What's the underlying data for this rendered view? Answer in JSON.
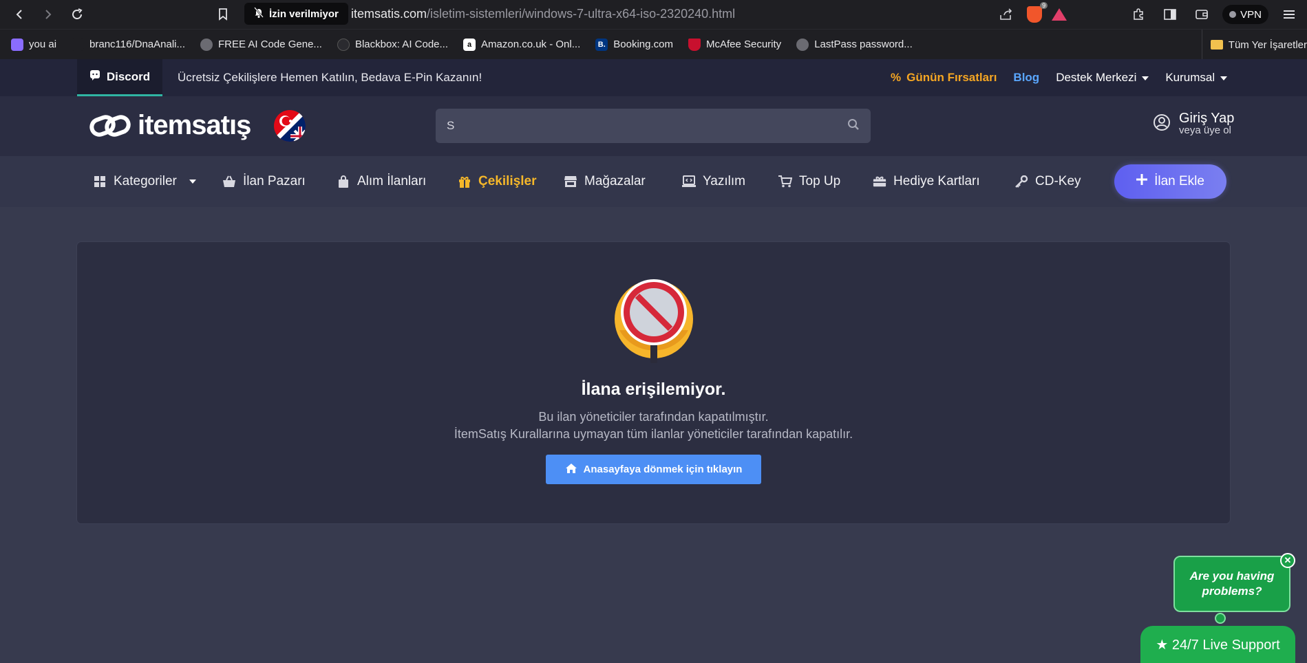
{
  "browser": {
    "permission_badge": "İzin verilmiyor",
    "url_domain": "itemsatis.com",
    "url_path": "/isletim-sistemleri/windows-7-ultra-x64-iso-2320240.html",
    "brave_count": "9",
    "vpn_label": "VPN"
  },
  "bookmarks": {
    "items": [
      {
        "label": "you ai",
        "color": "#8a6cff"
      },
      {
        "label": "branc116/DnaAnali...",
        "color": "#1f1f23"
      },
      {
        "label": "FREE AI Code Gene...",
        "color": "#6b6b72"
      },
      {
        "label": "Blackbox: AI Code...",
        "color": "#2a2a2f"
      },
      {
        "label": "Amazon.co.uk - Onl...",
        "color": "#ffffff"
      },
      {
        "label": "Booking.com",
        "color": "#003580"
      },
      {
        "label": "McAfee Security",
        "color": "#c8102e"
      },
      {
        "label": "LastPass password...",
        "color": "#6b6b72"
      }
    ],
    "all_bookmarks": "Tüm Yer İşaretler"
  },
  "topbar": {
    "discord": "Discord",
    "promo": "Ücretsiz Çekilişlere Hemen Katılın, Bedava E-Pin Kazanın!",
    "deals": "Günün Fırsatları",
    "blog": "Blog",
    "support": "Destek Merkezi",
    "corporate": "Kurumsal"
  },
  "header": {
    "logo_text": "itemsatış",
    "search_value": "S",
    "login_title": "Giriş Yap",
    "login_sub": "veya üye ol"
  },
  "nav": {
    "categories": "Kategoriler",
    "listings": "İlan Pazarı",
    "buy_listings": "Alım İlanları",
    "giveaways": "Çekilişler",
    "stores": "Mağazalar",
    "software": "Yazılım",
    "topup": "Top Up",
    "giftcards": "Hediye Kartları",
    "cdkey": "CD-Key",
    "add_listing": "İlan Ekle"
  },
  "content": {
    "title": "İlana erişilemiyor.",
    "desc1": "Bu ilan yöneticiler tarafından kapatılmıştır.",
    "desc2": "İtemSatış Kurallarına uymayan tüm ilanlar yöneticiler tarafından kapatılır.",
    "home_button": "Anasayfaya dönmek için tıklayın"
  },
  "support": {
    "question": "Are you having problems?",
    "live": "★ 24/7 Live Support"
  },
  "colors": {
    "accent_yellow": "#f5b72a",
    "blog_blue": "#5aa7ff",
    "button_blue": "#4d8ff5",
    "support_green": "#1fae4e"
  }
}
